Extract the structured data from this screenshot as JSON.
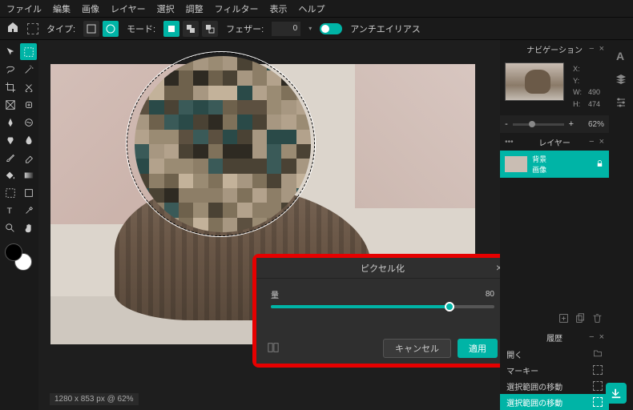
{
  "menu": [
    "ファイル",
    "編集",
    "画像",
    "レイヤー",
    "選択",
    "調整",
    "フィルター",
    "表示",
    "ヘルプ"
  ],
  "optbar": {
    "type_label": "タイプ:",
    "mode_label": "モード:",
    "feather_label": "フェザー:",
    "feather_value": "0",
    "aa_label": "アンチエイリアス"
  },
  "status": "1280 x 853 px @ 62%",
  "dialog": {
    "title": "ピクセル化",
    "amount_label": "量",
    "amount_value": "80",
    "cancel": "キャンセル",
    "apply": "適用"
  },
  "panels": {
    "navi_title": "ナビゲーション",
    "xy": {
      "x": "X:",
      "y": "Y:",
      "w": "W:",
      "h": "H:",
      "wv": "490",
      "hv": "474"
    },
    "zoom_minus": "-",
    "zoom_plus": "+",
    "zoom_value": "62%",
    "layers_title": "レイヤー",
    "layer_name_1": "背景",
    "layer_name_2": "画像",
    "history_title": "履歴",
    "history_items": [
      "開く",
      "マーキー",
      "選択範囲の移動",
      "選択範囲の移動"
    ],
    "dots": "•••"
  }
}
